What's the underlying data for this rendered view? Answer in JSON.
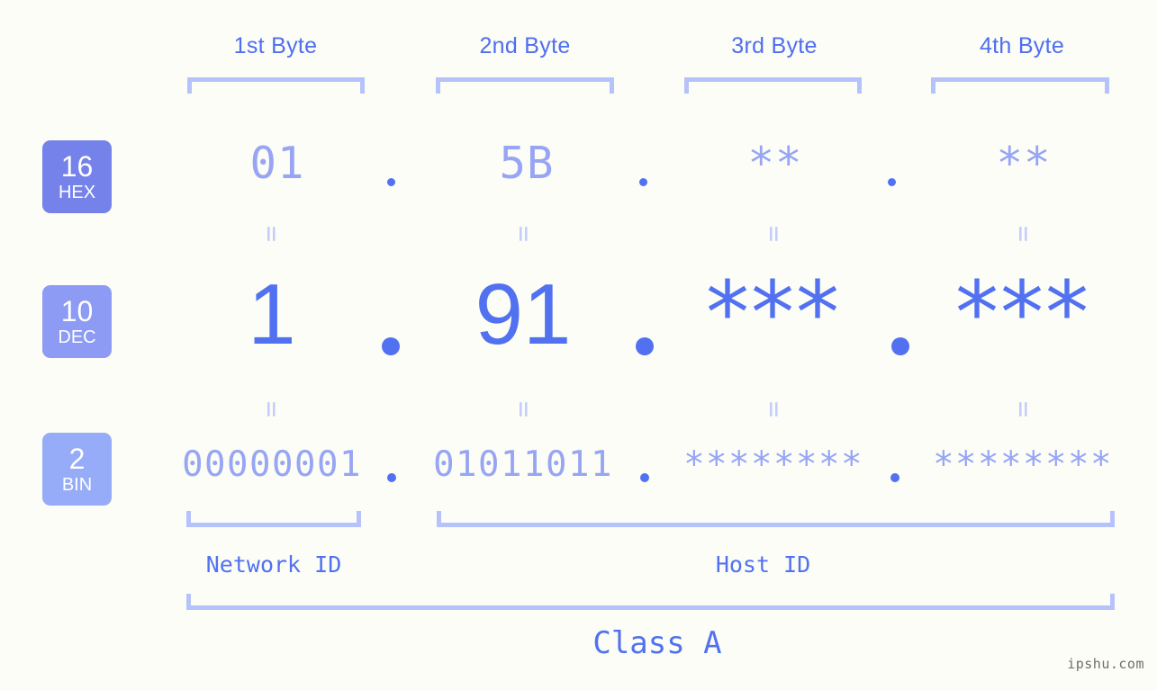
{
  "meta": {
    "background_color": "#fbfdf6",
    "accent_color": "#5271f0",
    "light_accent_color": "#97a5f4",
    "bracket_color": "#b6c2fb",
    "watermark": "ipshu.com"
  },
  "header": {
    "bytes": [
      {
        "label": "1st Byte"
      },
      {
        "label": "2nd Byte"
      },
      {
        "label": "3rd Byte"
      },
      {
        "label": "4th Byte"
      }
    ]
  },
  "bases": [
    {
      "num": "16",
      "abbr": "HEX",
      "color": "#7582e9"
    },
    {
      "num": "10",
      "abbr": "DEC",
      "color": "#8d9bf4"
    },
    {
      "num": "2",
      "abbr": "BIN",
      "color": "#96acf8"
    }
  ],
  "rows": {
    "hex": {
      "base_num": "16",
      "base_abbr": "HEX",
      "values": [
        "01",
        "5B",
        "**",
        "**"
      ],
      "separator": "."
    },
    "dec": {
      "base_num": "10",
      "base_abbr": "DEC",
      "values": [
        "1",
        "91",
        "***",
        "***"
      ],
      "separator": "."
    },
    "bin": {
      "base_num": "2",
      "base_abbr": "BIN",
      "values": [
        "00000001",
        "01011011",
        "********",
        "********"
      ],
      "separator": "."
    }
  },
  "equals_glyph": "=",
  "footer": {
    "network_id_label": "Network ID",
    "host_id_label": "Host ID",
    "class_label": "Class A"
  }
}
